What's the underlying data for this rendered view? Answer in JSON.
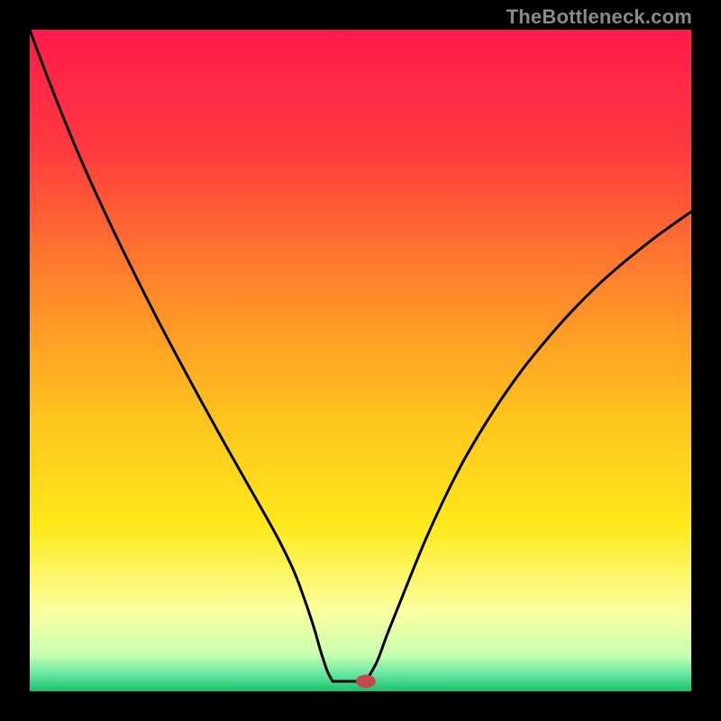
{
  "watermark": "TheBottleneck.com",
  "chart_data": {
    "type": "line",
    "title": "",
    "xlabel": "",
    "ylabel": "",
    "xlim": [
      0,
      100
    ],
    "ylim": [
      0,
      100
    ],
    "background_gradient_stops": [
      {
        "offset": 0.0,
        "color": "#ff1a4b"
      },
      {
        "offset": 0.18,
        "color": "#ff3a3f"
      },
      {
        "offset": 0.4,
        "color": "#ff8a2a"
      },
      {
        "offset": 0.58,
        "color": "#ffc21e"
      },
      {
        "offset": 0.75,
        "color": "#ffe91a"
      },
      {
        "offset": 0.88,
        "color": "#fbffa0"
      },
      {
        "offset": 0.945,
        "color": "#c8ffb0"
      },
      {
        "offset": 0.975,
        "color": "#63e6a0"
      },
      {
        "offset": 1.0,
        "color": "#19c06a"
      }
    ],
    "curve_left": [
      {
        "x": 0.0,
        "y": 100.0
      },
      {
        "x": 3.0,
        "y": 92.0
      },
      {
        "x": 6.0,
        "y": 84.5
      },
      {
        "x": 9.0,
        "y": 77.5
      },
      {
        "x": 12.0,
        "y": 71.0
      },
      {
        "x": 15.0,
        "y": 64.8
      },
      {
        "x": 18.0,
        "y": 58.8
      },
      {
        "x": 21.0,
        "y": 53.0
      },
      {
        "x": 24.0,
        "y": 47.4
      },
      {
        "x": 27.0,
        "y": 41.9
      },
      {
        "x": 30.0,
        "y": 36.5
      },
      {
        "x": 33.0,
        "y": 31.2
      },
      {
        "x": 36.0,
        "y": 25.9
      },
      {
        "x": 38.0,
        "y": 22.2
      },
      {
        "x": 40.0,
        "y": 18.0
      },
      {
        "x": 41.5,
        "y": 14.0
      },
      {
        "x": 43.0,
        "y": 9.5
      },
      {
        "x": 44.0,
        "y": 6.0
      },
      {
        "x": 45.0,
        "y": 3.0
      },
      {
        "x": 45.8,
        "y": 1.5
      }
    ],
    "curve_flat": [
      {
        "x": 45.8,
        "y": 1.5
      },
      {
        "x": 50.8,
        "y": 1.5
      }
    ],
    "curve_right": [
      {
        "x": 50.8,
        "y": 1.5
      },
      {
        "x": 52.5,
        "y": 4.5
      },
      {
        "x": 54.0,
        "y": 8.5
      },
      {
        "x": 56.0,
        "y": 13.5
      },
      {
        "x": 58.0,
        "y": 18.5
      },
      {
        "x": 60.0,
        "y": 23.3
      },
      {
        "x": 63.0,
        "y": 29.8
      },
      {
        "x": 66.0,
        "y": 35.6
      },
      {
        "x": 70.0,
        "y": 42.2
      },
      {
        "x": 74.0,
        "y": 48.0
      },
      {
        "x": 78.0,
        "y": 53.0
      },
      {
        "x": 82.0,
        "y": 57.5
      },
      {
        "x": 86.0,
        "y": 61.5
      },
      {
        "x": 90.0,
        "y": 65.0
      },
      {
        "x": 94.0,
        "y": 68.2
      },
      {
        "x": 97.0,
        "y": 70.4
      },
      {
        "x": 100.0,
        "y": 72.5
      }
    ],
    "marker": {
      "x": 50.8,
      "y": 1.5,
      "rx": 1.5,
      "ry": 1.0,
      "color": "#c24a4a"
    },
    "annotations": []
  }
}
